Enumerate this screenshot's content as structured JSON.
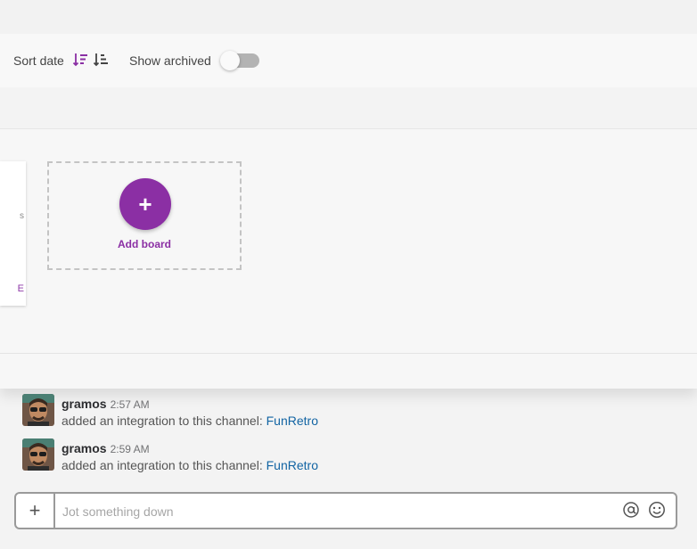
{
  "toolbar": {
    "sort_label": "Sort date",
    "sort_desc_icon": "sort-descending-icon",
    "sort_asc_icon": "sort-ascending-icon",
    "archived_label": "Show archived",
    "archived_on": false
  },
  "boards": {
    "partial_card_fragment_1": "s",
    "partial_card_fragment_2": "E",
    "add_board_label": "Add board",
    "add_board_icon": "+"
  },
  "messages": [
    {
      "user": "gramos",
      "time": "2:57 AM",
      "text": "added an integration to this channel: ",
      "link": "FunRetro"
    },
    {
      "user": "gramos",
      "time": "2:59 AM",
      "text": "added an integration to this channel: ",
      "link": "FunRetro"
    }
  ],
  "composer": {
    "plus_label": "+",
    "placeholder": "Jot something down",
    "mention_icon": "at-icon",
    "emoji_icon": "emoji-icon"
  },
  "colors": {
    "accent": "#8b2fa4",
    "link": "#1264a3"
  }
}
